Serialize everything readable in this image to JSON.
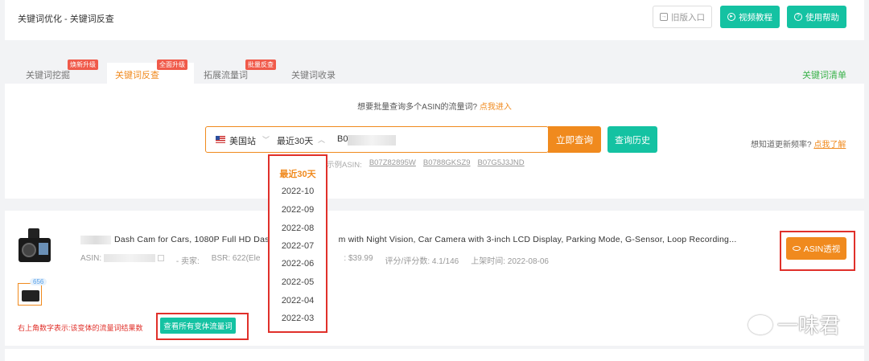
{
  "header": {
    "breadcrumb": "关键词优化 - 关键词反查",
    "old_version": "旧版入口",
    "video_tutorial": "视频教程",
    "help": "使用帮助"
  },
  "tabs": [
    {
      "label": "关键词挖掘",
      "tag": "焕新升级"
    },
    {
      "label": "关键词反查",
      "tag": "全面升级"
    },
    {
      "label": "拓展流量词",
      "tag": "批量反查"
    },
    {
      "label": "关键词收录",
      "tag": ""
    }
  ],
  "keyword_list": "关键词清单",
  "search": {
    "hint": "想要批量查询多个ASIN的流量词?",
    "hint_link": "点我进入",
    "site": "美国站",
    "range": "最近30天",
    "asin_prefix": "B0",
    "query_button": "立即查询",
    "history_button": "查询历史",
    "freq_hint": "想知道更新频率?",
    "freq_link": "点我了解",
    "example_label": "示例ASIN:",
    "examples": [
      "B07Z82895W",
      "B0788GKSZ9",
      "B07G5J3JND"
    ]
  },
  "dropdown": {
    "options": [
      "最近30天",
      "2022-10",
      "2022-09",
      "2022-08",
      "2022-07",
      "2022-06",
      "2022-05",
      "2022-04",
      "2022-03"
    ],
    "selected": "最近30天"
  },
  "product": {
    "title_a": "Dash Cam for Cars, 1080P Full HD Dash",
    "title_b": "m with Night Vision, Car Camera with 3-inch LCD Display, Parking Mode, G-Sensor, Loop Recording...",
    "asin_label": "ASIN:",
    "seller_label": "- 卖家:",
    "bsr": "BSR: 622(Ele",
    "price_tail": ": $39.99",
    "rating": "评分/评分数: 4.1/146",
    "launch": "上架时间: 2022-08-06",
    "asin_button": "ASIN透视",
    "variant_count": "656",
    "variant_note": "右上角数字表示:该变体的流量词结果数",
    "variant_button": "查看所有变体流量词"
  },
  "watermark": "一味君",
  "colors": {
    "accent": "#f08a1e",
    "teal": "#14c2a2",
    "highlight": "#e0302a"
  }
}
